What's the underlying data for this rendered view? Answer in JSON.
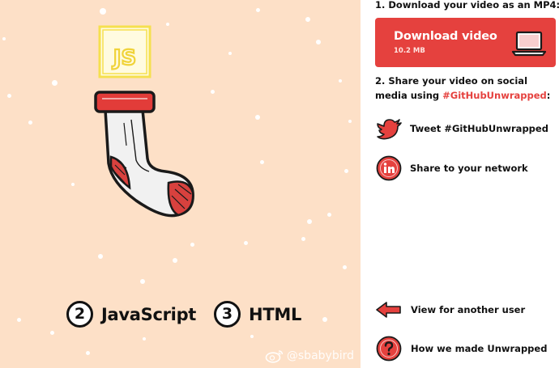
{
  "preview": {
    "badge_text": "JS",
    "languages": [
      {
        "rank": "2",
        "name": "JavaScript"
      },
      {
        "rank": "3",
        "name": "HTML"
      }
    ],
    "watermark": "@sbabybird"
  },
  "download": {
    "step_text": "1. Download your video as an MP4:",
    "button_label": "Download video",
    "file_size": "10.2 MB"
  },
  "share": {
    "step_text": "2. Share your video on social media using ",
    "hashtag": "#GitHubUnwrapped",
    "step_suffix": ":",
    "tweet_label": "Tweet #GitHubUnwrapped",
    "linkedin_label": "Share to your network"
  },
  "links": {
    "another_user": "View for another user",
    "how_made": "How we made Unwrapped"
  },
  "colors": {
    "preview_background": "#fde0c7",
    "accent_red": "#e5413e",
    "sock_body": "#f1f1f1",
    "js_yellow": "#f5e04f"
  },
  "icons": {
    "download": "laptop-icon",
    "tweet": "twitter-bird-icon",
    "share": "linkedin-icon",
    "another_user": "arrow-left-icon",
    "how_made": "question-mark-icon"
  }
}
